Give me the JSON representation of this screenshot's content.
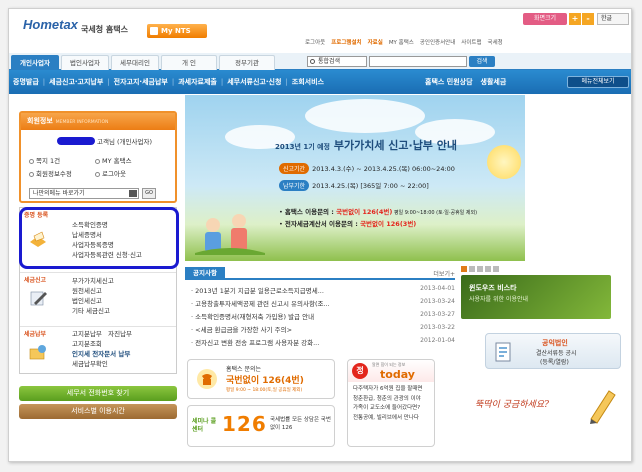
{
  "header": {
    "logo_text": "Hometax",
    "logo_sub": "국세청 홈택스",
    "mynts": "My NTS",
    "font_size": "화면크기",
    "font_plus": "+",
    "font_minus": "-",
    "language": "한글",
    "utils": [
      "로그아웃",
      "프로그램설치",
      "자료실",
      "MY 홈택스",
      "공인인증서안내",
      "사이트맵",
      "국세청"
    ]
  },
  "tabs": [
    {
      "label": "개인사업자",
      "active": true
    },
    {
      "label": "법인사업자",
      "active": false
    },
    {
      "label": "세무대리인",
      "active": false
    },
    {
      "label": "개 인",
      "active": false
    },
    {
      "label": "정부기관",
      "active": false
    }
  ],
  "search": {
    "select": "통합검색",
    "button": "검색",
    "value": ""
  },
  "menubar": {
    "items": [
      "증명발급",
      "세금신고·고지납부",
      "전자고지·세금납부",
      "과세자료제출",
      "세무서류신고·신청",
      "조회서비스"
    ],
    "right": [
      "홈택스 민원상담",
      "생활세금"
    ],
    "all_menu": "메뉴전체보기"
  },
  "member": {
    "title": "회원정보",
    "title_en": "MEMBER INFORMATION",
    "greeting": "고객님 (개인사업자)",
    "links": [
      {
        "label": "쪽지 1건",
        "id": "msg"
      },
      {
        "label": "MY 홈택스",
        "id": "my"
      },
      {
        "label": "회원정보수정",
        "id": "edit"
      },
      {
        "label": "로그아웃",
        "id": "logout"
      }
    ],
    "shortcut": "나만의메뉴 바로가기",
    "go": "GO"
  },
  "services": [
    {
      "category": "증명 등록",
      "items": [
        "소득확인증명",
        "납세증명서",
        "사업자등록증명",
        "사업자등록관련 신청·신고"
      ]
    },
    {
      "category": "세금신고",
      "items": [
        "부가가치세신고",
        "원천세신고",
        "법인세신고",
        "기타 세금신고"
      ]
    },
    {
      "category": "세금납부",
      "items": [
        "고지분납부",
        "자진납부",
        "고지분조회",
        "인지세 전자문서 납부",
        "세금납부확인"
      ]
    }
  ],
  "side_buttons": {
    "phone": "세무서 전화번호 찾기",
    "hours": "서비스별 이용시간"
  },
  "banner": {
    "title_pre": "2013년 1기 예정",
    "title_main": "부가가치세 신고·납부 안내",
    "period_label": "신고기간",
    "period": "2013.4.3.(수) ~ 2013.4.25.(목) 06:00~24:00",
    "due_label": "납부기한",
    "due": "2013.4.25.(목) [365일 7:00 ~ 22:00]",
    "line1_pre": "홈택스 이용문의 : ",
    "line1_red": "국번없이 126(4번)",
    "line1_post": " 평일 9:00~18:00 (토·일·공휴일 제외)",
    "line2_pre": "전자세금계산서 이용문의 : ",
    "line2_red": "국번없이 126(3번)"
  },
  "notice": {
    "title": "공지사항",
    "more": "더보기+",
    "rows": [
      {
        "title": "2013년 1분기 지급분 일용근로소득지급명세...",
        "date": "2013-04-01"
      },
      {
        "title": "고용창출투자세액공제 관련 신고시 유의사항(조...",
        "date": "2013-03-24"
      },
      {
        "title": "소득확인증명서(재형저축 가입용) 발급 안내",
        "date": "2013-03-27"
      },
      {
        "title": "<세금 환급금을 가장한 사기 주의>",
        "date": "2013-03-22"
      },
      {
        "title": "전자신고 변환 전송 프로그램 사용자분 강화...",
        "date": "2012-01-04"
      }
    ]
  },
  "ad_phone": {
    "label": "홈택스 문의는",
    "number": "국번없이 126(4번)",
    "hours": "평일 9:00 ~ 18:00(토,일 공휴일 제외)"
  },
  "ad_126": {
    "left": "세미나 콜센터",
    "digits": "126",
    "right": "국세법률 모든 상담은 국번없이 126"
  },
  "today": {
    "badge": "정",
    "sub": "알면 힘이 되는 정보",
    "word": "today",
    "items": [
      "다주택자가 6억원 집을 팔때면",
      "청춘환급, 청춘의 관광의 이야",
      "가족이 교도소에 들어갔다면?",
      "전통공예, 빌리브에서 만나다"
    ]
  },
  "right": {
    "pager": [
      "1",
      "2",
      "3",
      "4",
      "5"
    ],
    "win_title": "윈도우즈 비스타",
    "win_sub": "사용자를 위한 이용안내",
    "pub_title": "공익법인",
    "pub_sub": "결산서류등 공시",
    "pub_sub2": "(등록/열람)",
    "hand_text": "뚝딱이 궁금하세요?"
  },
  "colors": {
    "accent": "#2b7fc3",
    "orange": "#ec7d14",
    "red": "#e3261c",
    "green": "#5a9e1e"
  }
}
